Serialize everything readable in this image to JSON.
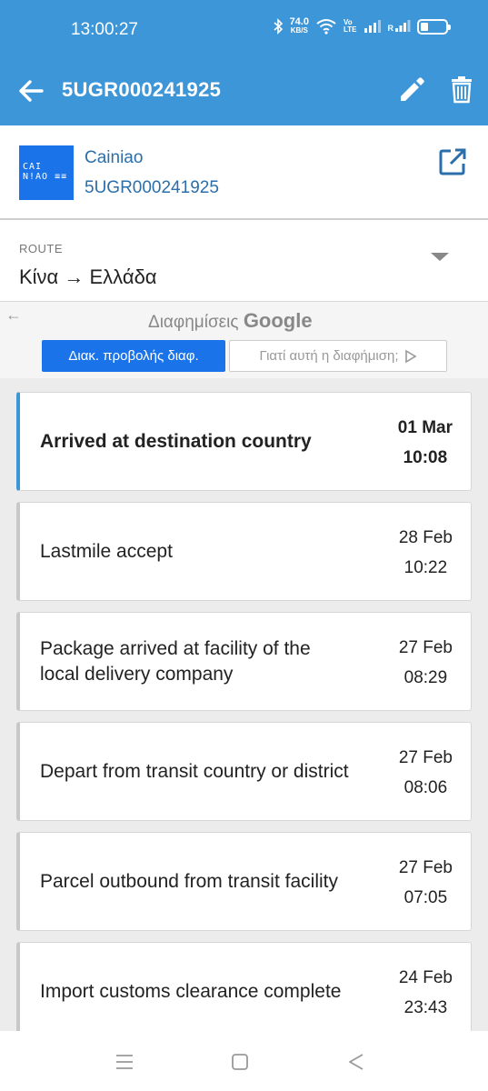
{
  "status_bar": {
    "time": "13:00:27",
    "net_speed_value": "74.0",
    "net_speed_unit": "KB/S",
    "volte_top": "Vo",
    "volte_bottom": "LTE",
    "sim2_label": "R"
  },
  "app_bar": {
    "title": "5UGR000241925",
    "back_icon": "arrow-back-icon",
    "edit_icon": "pencil-icon",
    "delete_icon": "trash-icon",
    "color": "#3d96d8"
  },
  "carrier": {
    "logo_text_line1": "CAI",
    "logo_text_line2": "N!AO ≡≡",
    "name": "Cainiao",
    "tracking_number": "5UGR000241925",
    "open_icon": "open-in-new-icon"
  },
  "route": {
    "label": "ROUTE",
    "value": "Κίνα → Ελλάδα"
  },
  "ad": {
    "title_prefix": "Διαφημίσεις",
    "title_brand": "Google",
    "primary_button": "Διακ. προβολής διαφ.",
    "secondary_button": "Γιατί αυτή η διαφήμιση;"
  },
  "events": [
    {
      "title": "Arrived at destination country",
      "date": "01 Mar",
      "time": "10:08",
      "active": true
    },
    {
      "title": "Lastmile accept",
      "date": "28 Feb",
      "time": "10:22",
      "active": false
    },
    {
      "title": "Package arrived at facility of the local delivery company",
      "date": "27 Feb",
      "time": "08:29",
      "active": false
    },
    {
      "title": "Depart from transit country or district",
      "date": "27 Feb",
      "time": "08:06",
      "active": false
    },
    {
      "title": "Parcel outbound from transit facility",
      "date": "27 Feb",
      "time": "07:05",
      "active": false
    },
    {
      "title": "Import customs clearance complete",
      "date": "24 Feb",
      "time": "23:43",
      "active": false
    }
  ],
  "nav_bar": {
    "recents_icon": "menu-lines-icon",
    "home_icon": "square-home-icon",
    "back_icon": "triangle-back-icon"
  }
}
